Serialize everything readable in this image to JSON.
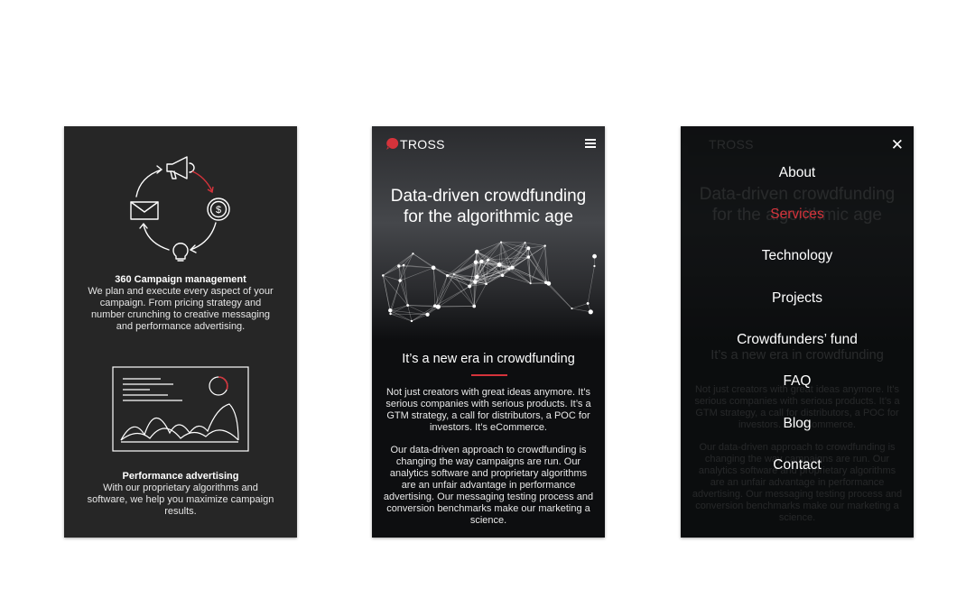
{
  "phone1": {
    "services": [
      {
        "icon": "campaign-cycle-icon",
        "title": "360 Campaign management",
        "desc": "We plan and execute every aspect of your campaign. From pricing strategy and number crunching to creative messaging and performance advertising."
      },
      {
        "icon": "analytics-dashboard-icon",
        "title": "Performance advertising",
        "desc": "With our proprietary algorithms and software, we help you maximize campaign results."
      }
    ]
  },
  "phone2": {
    "logo": "TROSS",
    "hero_title_l1": "Data-driven crowdfunding",
    "hero_title_l2": "for the algorithmic age",
    "era_title": "It’s a new era in crowdfunding",
    "para1": "Not just creators with great ideas anymore. It’s serious companies with serious products. It’s a GTM strategy, a call for distributors, a POC for investors. It’s eCommerce.",
    "para2": "Our data-driven approach to crowdfunding is changing the way campaigns are run. Our analytics software and proprietary algorithms are an unfair advantage in performance advertising. Our messaging testing process and conversion benchmarks make our marketing a science."
  },
  "phone3": {
    "close": "✕",
    "menu": [
      {
        "label": "About"
      },
      {
        "label": "Services",
        "active": true
      },
      {
        "label": "Technology"
      },
      {
        "label": "Projects"
      },
      {
        "label": "Crowdfunders’ fund"
      },
      {
        "label": "FAQ"
      },
      {
        "label": "Blog"
      },
      {
        "label": "Contact"
      }
    ]
  },
  "colors": {
    "accent": "#d5333b",
    "card_bg": "#262626",
    "dark_bg": "#0d0e10"
  }
}
